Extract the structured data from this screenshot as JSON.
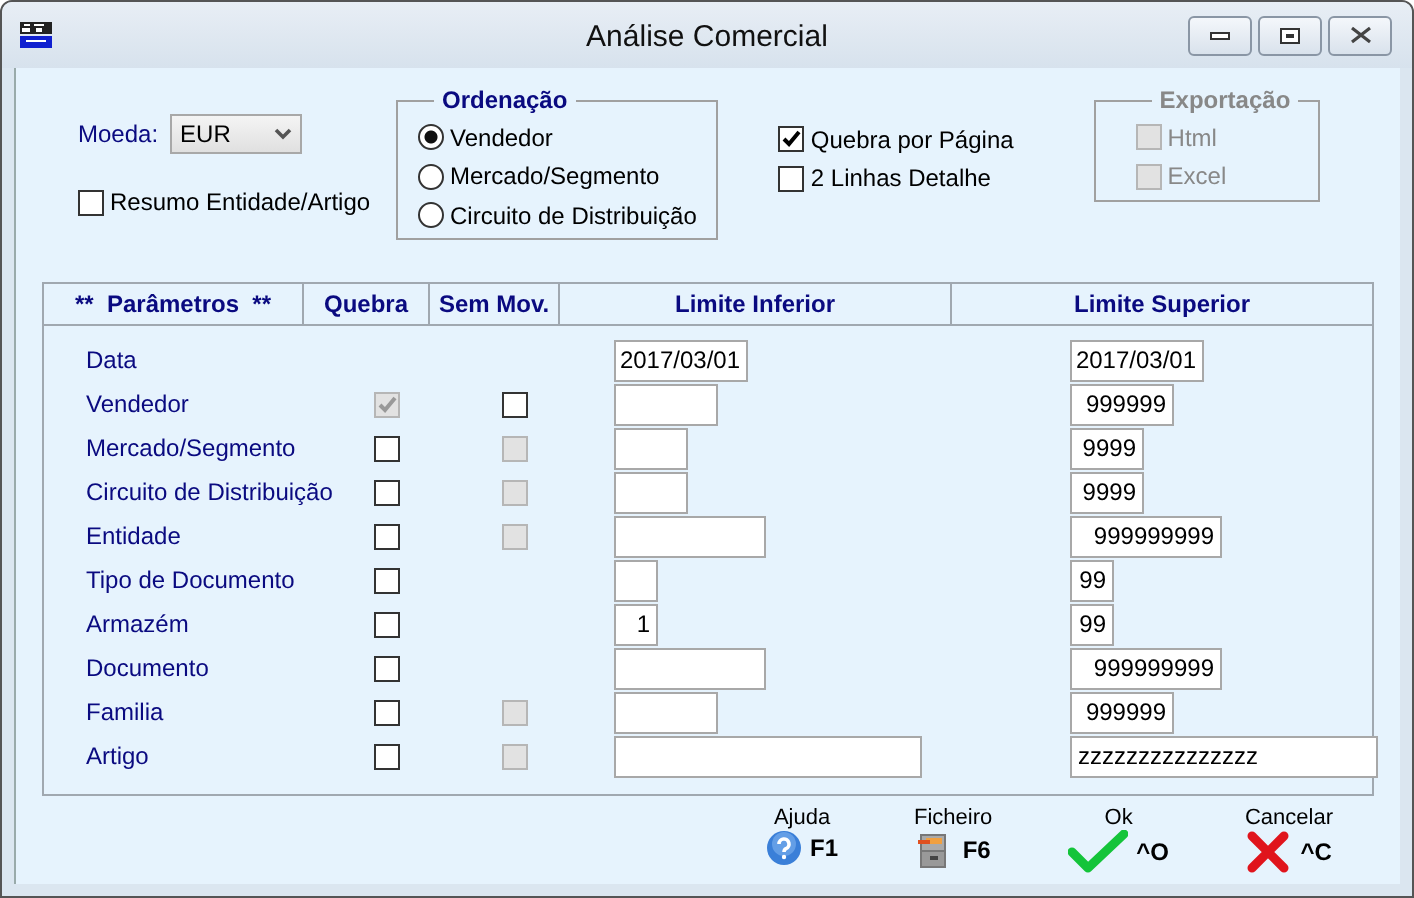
{
  "window": {
    "title": "Análise Comercial"
  },
  "currency": {
    "label": "Moeda:",
    "value": "EUR"
  },
  "summary_option": {
    "label": "Resumo Entidade/Artigo",
    "checked": false
  },
  "sorting": {
    "title": "Ordenação",
    "options": [
      {
        "label": "Vendedor",
        "selected": true
      },
      {
        "label": "Mercado/Segmento",
        "selected": false
      },
      {
        "label": "Circuito de Distribuição",
        "selected": false
      }
    ]
  },
  "page_options": [
    {
      "label": "Quebra por Página",
      "checked": true
    },
    {
      "label": "2 Linhas Detalhe",
      "checked": false
    }
  ],
  "export": {
    "title": "Exportação",
    "disabled": true,
    "options": [
      {
        "label": "Html",
        "checked": false
      },
      {
        "label": "Excel",
        "checked": false
      }
    ]
  },
  "table": {
    "columns": [
      "**  Parâmetros  **",
      "Quebra",
      "Sem Mov.",
      "Limite Inferior",
      "Limite Superior"
    ],
    "rows": [
      {
        "label": "Data",
        "lower": "2017/03/01",
        "upper": "2017/03/01"
      },
      {
        "label": "Vendedor",
        "quebra": {
          "checked": true,
          "disabled": true
        },
        "sem_mov": {
          "checked": false,
          "disabled": false
        },
        "lower": "",
        "upper": "999999"
      },
      {
        "label": "Mercado/Segmento",
        "quebra": {
          "checked": false,
          "disabled": false
        },
        "sem_mov": {
          "checked": false,
          "disabled": true
        },
        "lower": "",
        "upper": "9999"
      },
      {
        "label": "Circuito de Distribuição",
        "quebra": {
          "checked": false,
          "disabled": false
        },
        "sem_mov": {
          "checked": false,
          "disabled": true
        },
        "lower": "",
        "upper": "9999"
      },
      {
        "label": "Entidade",
        "quebra": {
          "checked": false,
          "disabled": false
        },
        "sem_mov": {
          "checked": false,
          "disabled": true
        },
        "lower": "",
        "upper": "999999999"
      },
      {
        "label": "Tipo de Documento",
        "quebra": {
          "checked": false,
          "disabled": false
        },
        "lower": "",
        "upper": "99"
      },
      {
        "label": "Armazém",
        "quebra": {
          "checked": false,
          "disabled": false
        },
        "lower": "1",
        "upper": "99"
      },
      {
        "label": "Documento",
        "quebra": {
          "checked": false,
          "disabled": false
        },
        "lower": "",
        "upper": "999999999"
      },
      {
        "label": "Familia",
        "quebra": {
          "checked": false,
          "disabled": false
        },
        "sem_mov": {
          "checked": false,
          "disabled": true
        },
        "lower": "",
        "upper": "999999"
      },
      {
        "label": "Artigo",
        "quebra": {
          "checked": false,
          "disabled": false
        },
        "sem_mov": {
          "checked": false,
          "disabled": true
        },
        "lower": "",
        "upper": "zzzzzzzzzzzzzzz"
      }
    ]
  },
  "footer_buttons": [
    {
      "kind": "help",
      "label": "Ajuda",
      "key": "F1"
    },
    {
      "kind": "file",
      "label": "Ficheiro",
      "key": "F6"
    },
    {
      "kind": "ok",
      "label": "Ok",
      "key": "^O"
    },
    {
      "kind": "cancel",
      "label": "Cancelar",
      "key": "^C"
    }
  ]
}
